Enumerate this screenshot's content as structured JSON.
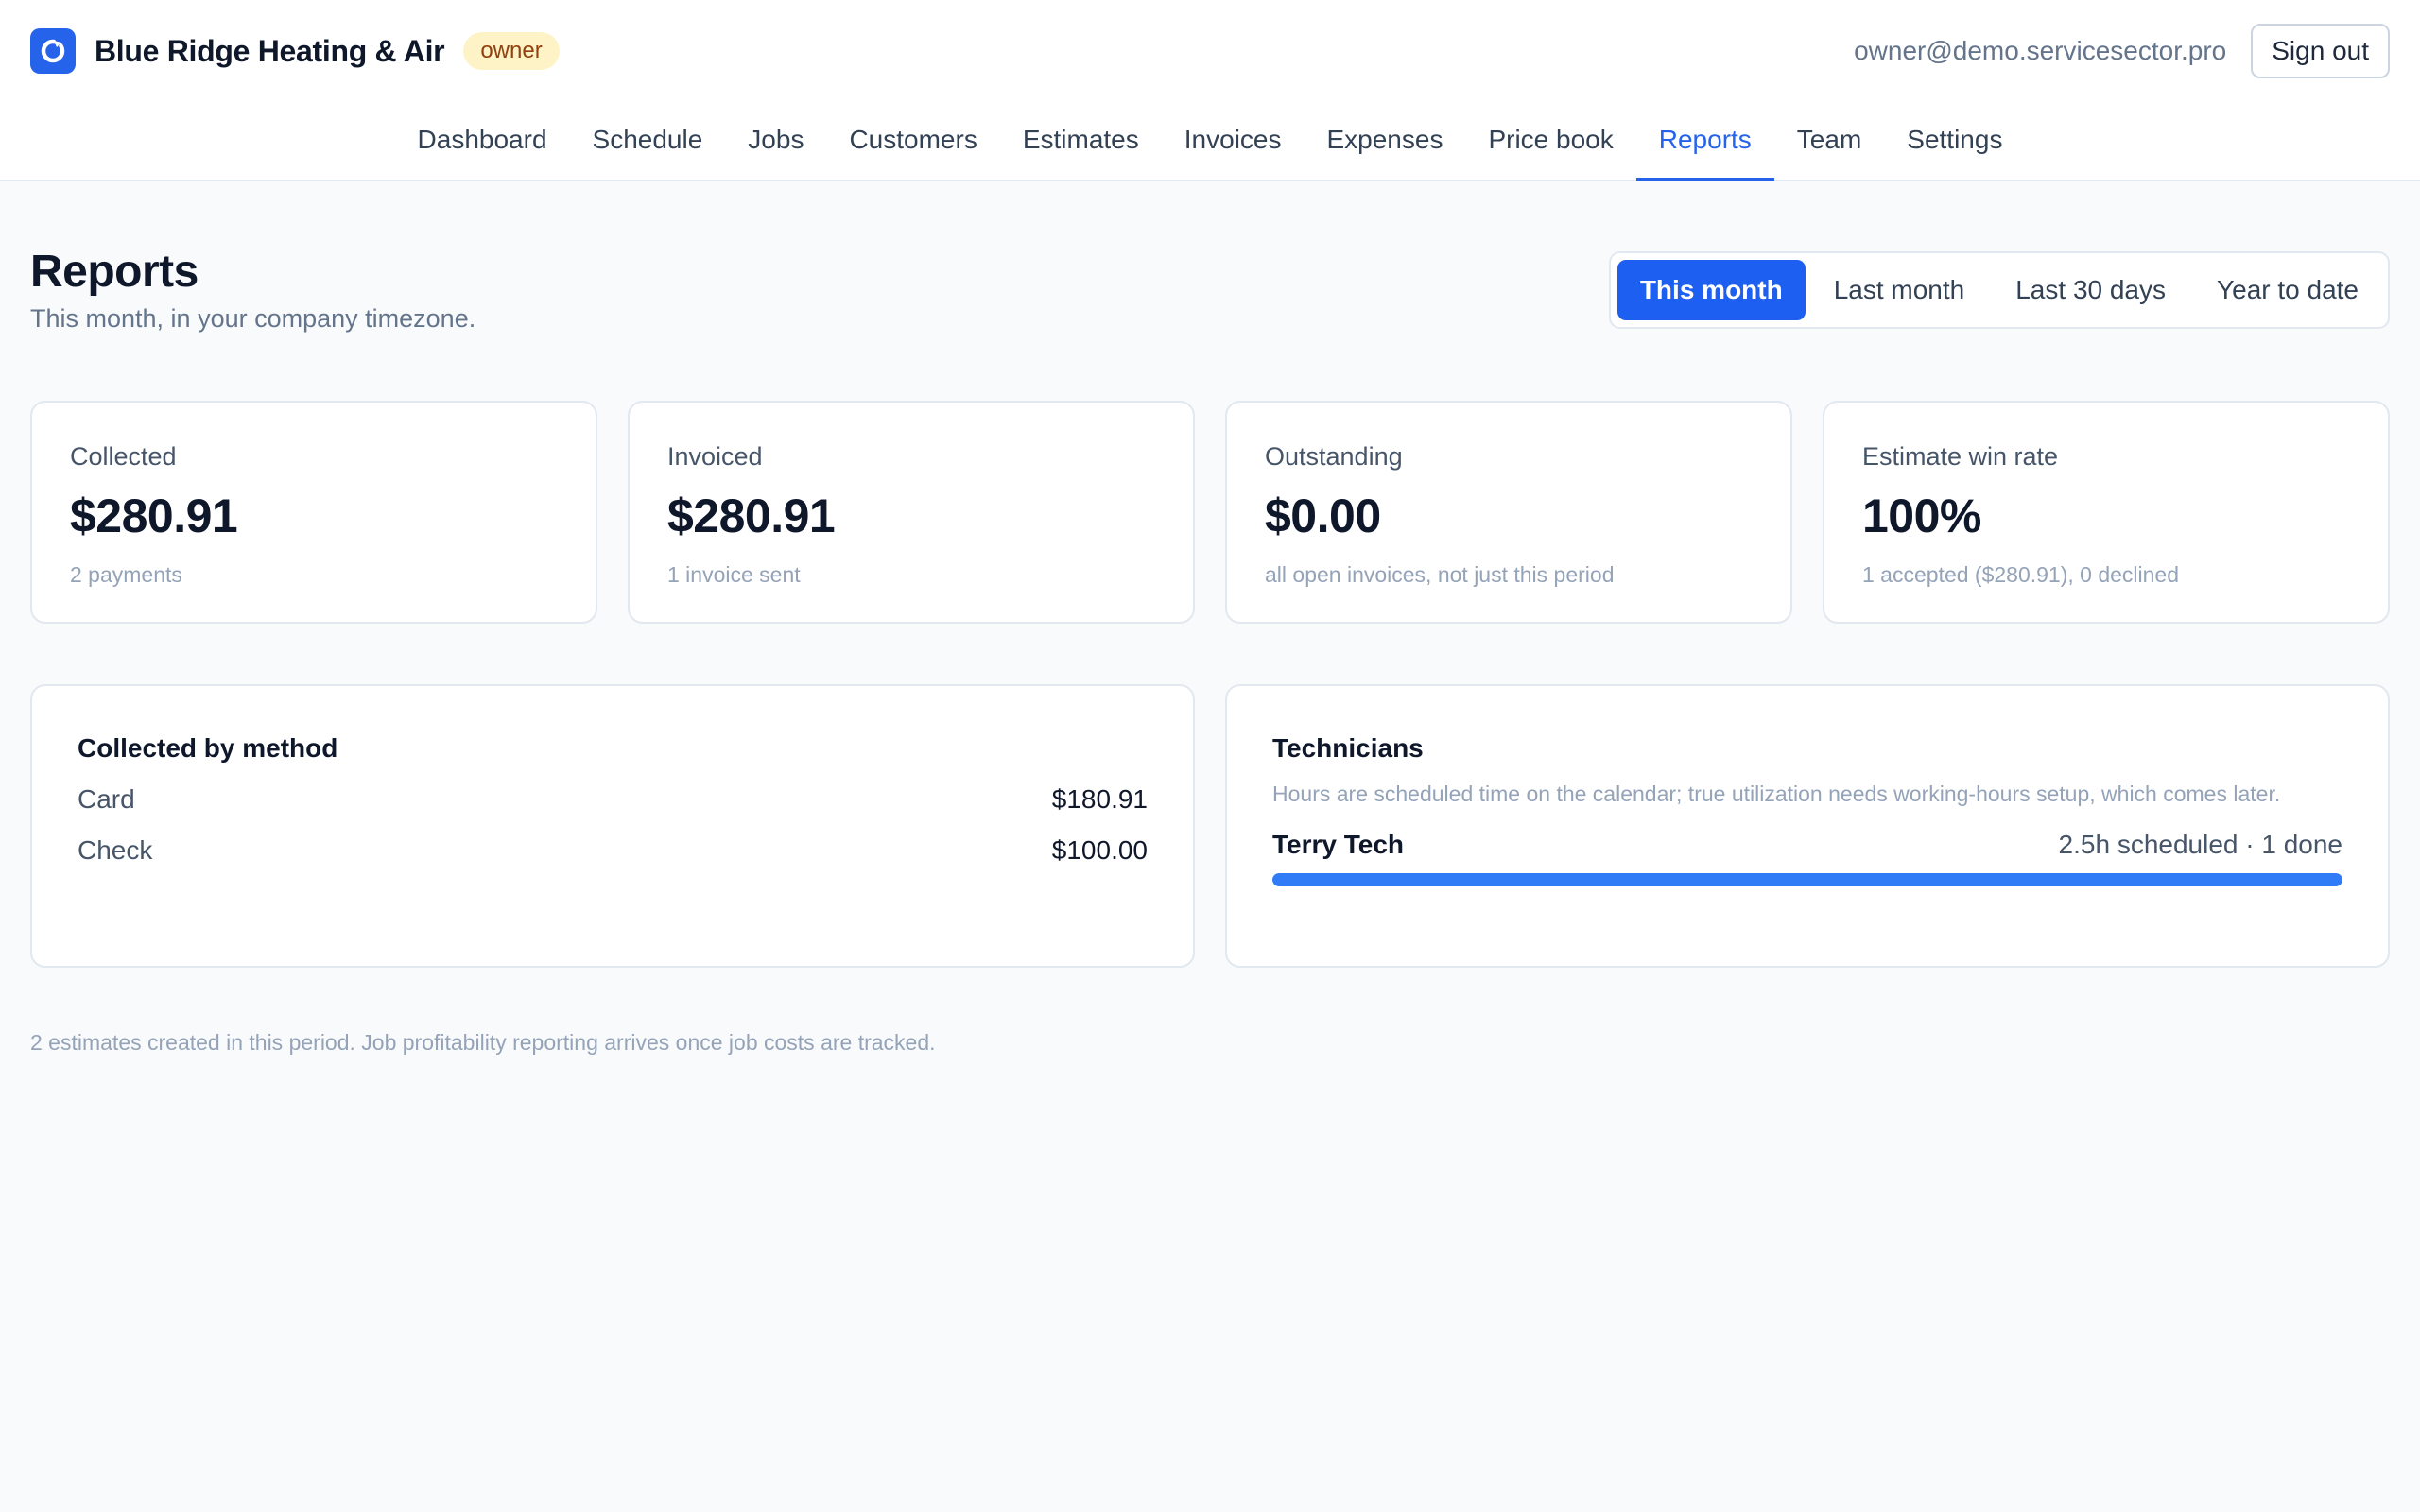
{
  "header": {
    "app_name": "Blue Ridge Heating & Air",
    "role_badge": "owner",
    "user_email": "owner@demo.servicesector.pro",
    "sign_out_label": "Sign out",
    "logo_icon": "refresh-circle-icon",
    "accent_color": "#2563eb"
  },
  "nav": {
    "items": [
      {
        "label": "Dashboard"
      },
      {
        "label": "Schedule"
      },
      {
        "label": "Jobs"
      },
      {
        "label": "Customers"
      },
      {
        "label": "Estimates"
      },
      {
        "label": "Invoices"
      },
      {
        "label": "Expenses"
      },
      {
        "label": "Price book"
      },
      {
        "label": "Reports"
      },
      {
        "label": "Team"
      },
      {
        "label": "Settings"
      }
    ],
    "active": "Reports"
  },
  "page": {
    "title": "Reports",
    "subtitle": "This month, in your company timezone."
  },
  "date_range": {
    "options": [
      {
        "label": "This month"
      },
      {
        "label": "Last month"
      },
      {
        "label": "Last 30 days"
      },
      {
        "label": "Year to date"
      }
    ],
    "selected": "This month"
  },
  "stats": [
    {
      "label": "Collected",
      "value": "$280.91",
      "note": "2 payments"
    },
    {
      "label": "Invoiced",
      "value": "$280.91",
      "note": "1 invoice sent"
    },
    {
      "label": "Outstanding",
      "value": "$0.00",
      "note": "all open invoices, not just this period"
    },
    {
      "label": "Estimate win rate",
      "value": "100%",
      "note": "1 accepted ($280.91), 0 declined"
    }
  ],
  "collected_by_method": {
    "title": "Collected by method",
    "rows": [
      {
        "method": "Card",
        "amount": "$180.91"
      },
      {
        "method": "Check",
        "amount": "$100.00"
      }
    ]
  },
  "technicians": {
    "title": "Technicians",
    "description": "Hours are scheduled time on the calendar; true utilization needs working-hours setup, which comes later.",
    "rows": [
      {
        "name": "Terry Tech",
        "stats": "2.5h scheduled · 1 done",
        "utilization": 1.0
      }
    ]
  },
  "footnote": "2 estimates created in this period. Job profitability reporting arrives once job costs are tracked."
}
